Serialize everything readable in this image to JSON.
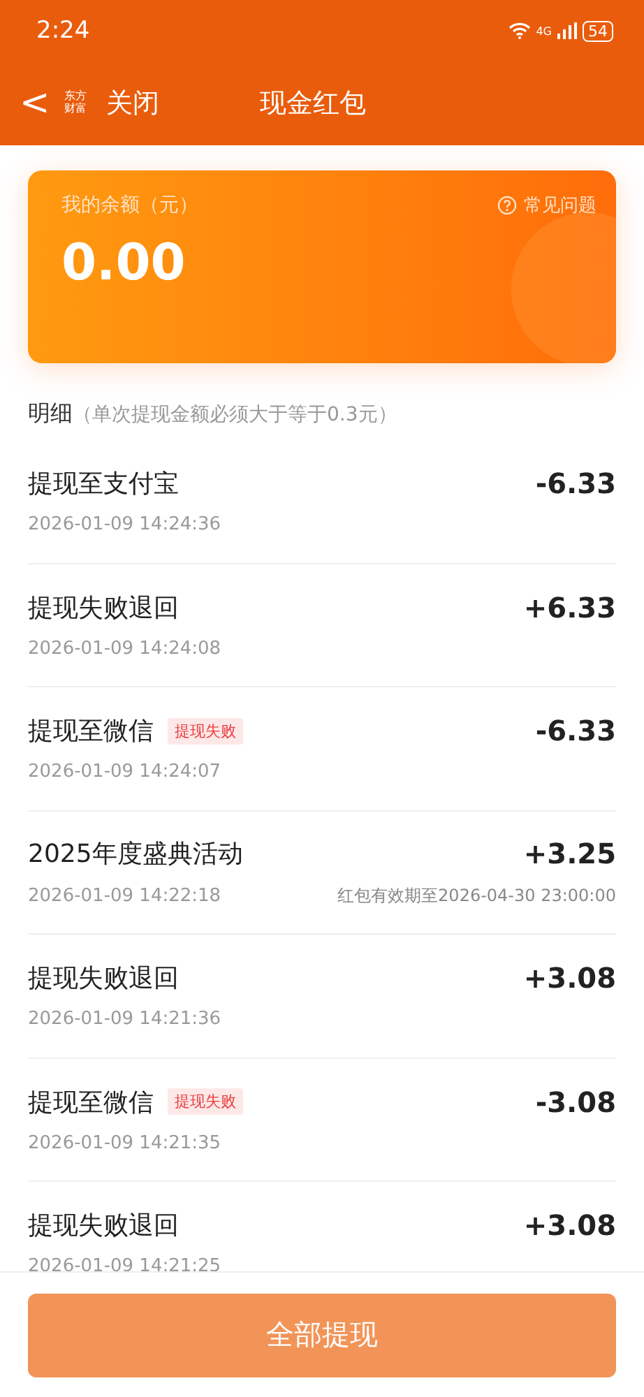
{
  "status_bar": {
    "time": "2:24",
    "network": "4G",
    "battery": "54"
  },
  "nav": {
    "back": "<",
    "logo": "东方财富",
    "close": "关闭",
    "title": "现金红包"
  },
  "balance_card": {
    "label": "我的余额（元）",
    "amount": "0.00",
    "faq": "常见问题"
  },
  "details": {
    "title": "明细",
    "note": "（单次提现金额必须大于等于0.3元）"
  },
  "records": [
    {
      "title": "提现至支付宝",
      "time": "2026-01-09 14:24:36",
      "amount": "-6.33"
    },
    {
      "title": "提现失败退回",
      "time": "2026-01-09 14:24:08",
      "amount": "+6.33"
    },
    {
      "title": "提现至微信",
      "tag": "提现失败",
      "time": "2026-01-09 14:24:07",
      "amount": "-6.33"
    },
    {
      "title": "2025年度盛典活动",
      "time": "2026-01-09 14:22:18",
      "expiry": "红包有效期至2026-04-30 23:00:00",
      "amount": "+3.25"
    },
    {
      "title": "提现失败退回",
      "time": "2026-01-09 14:21:36",
      "amount": "+3.08"
    },
    {
      "title": "提现至微信",
      "tag": "提现失败",
      "time": "2026-01-09 14:21:35",
      "amount": "-3.08"
    },
    {
      "title": "提现失败退回",
      "time": "2026-01-09 14:21:25",
      "amount": "+3.08"
    }
  ],
  "withdraw_button": {
    "label": "全部提现",
    "disabled": true
  }
}
